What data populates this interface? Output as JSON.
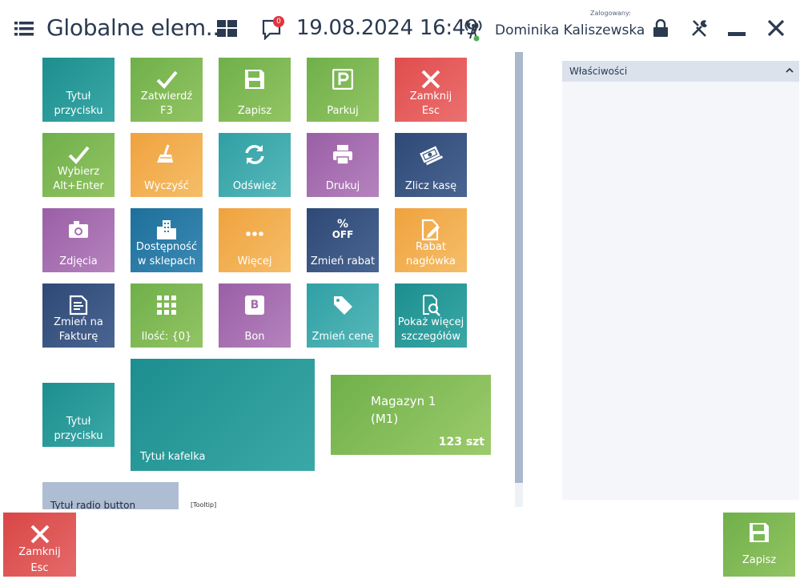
{
  "header": {
    "title": "Globalne elem...",
    "notifications_count": "0",
    "datetime": "19.08.2024 16:49",
    "logged_label": "Zalogowany:",
    "user_name": "Dominika Kaliszewska"
  },
  "tiles": [
    {
      "label": "Tytuł\nprzycisku",
      "color": "#1d8e8f",
      "icon": "none"
    },
    {
      "label": "Zatwierdź\nF3",
      "color": "#6fb04a",
      "icon": "check-icon"
    },
    {
      "label": "Zapisz",
      "color": "#6fb04a",
      "icon": "save-icon"
    },
    {
      "label": "Parkuj",
      "color": "#6fb04a",
      "icon": "parking-icon"
    },
    {
      "label": "Zamknij\nEsc",
      "color": "#e04d4d",
      "icon": "close-icon"
    },
    {
      "label": "Wybierz\nAlt+Enter",
      "color": "#6fb04a",
      "icon": "check-icon"
    },
    {
      "label": "Wyczyść",
      "color": "#f0a23e",
      "icon": "broom-icon"
    },
    {
      "label": "Odśwież",
      "color": "#2fa0a4",
      "icon": "refresh-icon"
    },
    {
      "label": "Drukuj",
      "color": "#9a5fa6",
      "icon": "printer-icon"
    },
    {
      "label": "Zlicz kasę",
      "color": "#2e4975",
      "icon": "money-icon"
    },
    {
      "label": "Zdjęcia",
      "color": "#9a5fa6",
      "icon": "camera-icon"
    },
    {
      "label": "Dostępność\nw sklepach",
      "color": "#1e6f9b",
      "icon": "buildings-icon"
    },
    {
      "label": "Więcej",
      "color": "#f0a23e",
      "icon": "more-icon"
    },
    {
      "label": "Zmień rabat",
      "color": "#2e4975",
      "icon": "percent-off-icon",
      "icon_text_top": "%",
      "icon_text_bottom": "OFF"
    },
    {
      "label": "Rabat\nnagłówka",
      "color": "#f0a23e",
      "icon": "document-edit-icon"
    },
    {
      "label": "Zmień na\nFakturę",
      "color": "#2e4975",
      "icon": "invoice-icon"
    },
    {
      "label": "Ilość: {0}",
      "color": "#6fb04a",
      "icon": "grid-icon"
    },
    {
      "label": "Bon",
      "color": "#9a5fa6",
      "icon": "voucher-icon",
      "icon_text": "B"
    },
    {
      "label": "Zmień cenę",
      "color": "#2fa0a4",
      "icon": "tag-icon"
    },
    {
      "label": "Pokaż więcej\nszczegółów",
      "color": "#1d8e8f",
      "icon": "details-icon"
    },
    {
      "label": "Tytuł\nprzycisku",
      "color": "#1d8e8f",
      "icon": "none"
    }
  ],
  "big_tile": {
    "label": "Tytuł kafelka"
  },
  "stock_tile": {
    "name": "Magazyn 1\n(M1)",
    "qty": "123 szt"
  },
  "radio_button": {
    "label": "Tytuł radio button"
  },
  "tooltip": "[Tooltip]",
  "properties": {
    "title": "Właściwości"
  },
  "bottom": {
    "close_label": "Zamknij\nEsc",
    "save_label": "Zapisz"
  }
}
